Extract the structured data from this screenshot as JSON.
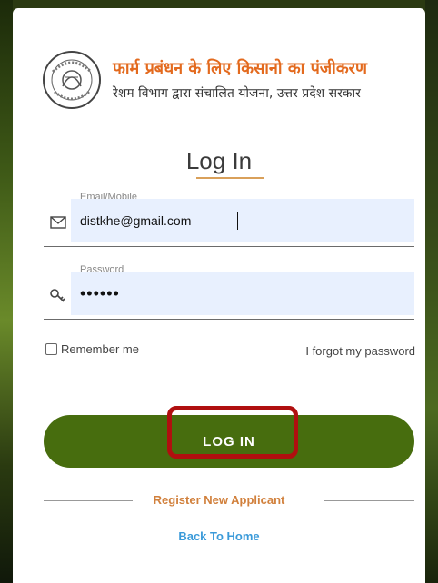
{
  "header": {
    "title": "फार्म प्रबंधन के लिए किसानो का पंजीकरण",
    "subtitle": "रेशम विभाग द्वारा संचालित योजना, उत्तर प्रदेश सरकार"
  },
  "form": {
    "heading": "Log In",
    "email": {
      "label": "Email/Mobile",
      "value": "distkhe@gmail.com",
      "icon": "envelope-icon"
    },
    "password": {
      "label": "Password",
      "value": "••••••",
      "icon": "key-icon"
    },
    "remember_label": "Remember me",
    "remember_checked": false,
    "forgot_label": "I forgot my password",
    "submit_label": "LOG IN"
  },
  "links": {
    "register": "Register New Applicant",
    "back_home": "Back To Home"
  },
  "colors": {
    "brand_title": "#e36a1e",
    "button": "#476d0e",
    "highlight": "#b00f0f",
    "register_link": "#d1803c",
    "home_link": "#3a9ad9",
    "input_bg": "#e8f0fe"
  }
}
